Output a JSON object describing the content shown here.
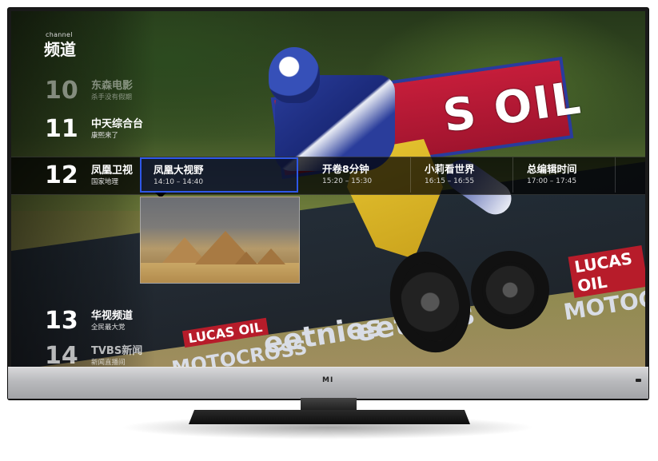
{
  "header": {
    "caption": "channel",
    "title": "频道"
  },
  "channels_above": [
    {
      "number": "10",
      "name": "东森电影",
      "program": "杀手没有假期"
    },
    {
      "number": "11",
      "name": "中天综合台",
      "program": "康熙来了"
    }
  ],
  "current_channel": {
    "number": "12",
    "name": "凤凰卫视",
    "program": "国家地理"
  },
  "programs": [
    {
      "title": "凤凰大视野",
      "time": "14:10 – 14:40",
      "selected": true
    },
    {
      "title": "开卷8分钟",
      "time": "15:20 – 15:30",
      "selected": false
    },
    {
      "title": "小莉看世界",
      "time": "16:15 – 16:55",
      "selected": false
    },
    {
      "title": "总编辑时间",
      "time": "17:00 – 17:45",
      "selected": false
    }
  ],
  "channels_below": [
    {
      "number": "13",
      "name": "华视频道",
      "program": "全民最大党"
    },
    {
      "number": "14",
      "name": "TVBS新闻",
      "program": "新闻直播间"
    }
  ],
  "background_signage": {
    "top_banner": "S OIL",
    "barrier_1": "eetnies",
    "barrier_2": "eetnies",
    "barrier_3": "MOTOCROSS",
    "barrier_4": "MOTOCROSS",
    "barrier_5": "LUCAS OIL",
    "barrier_6": "LUCAS OIL"
  },
  "tv": {
    "brand_logo": "MI"
  },
  "colors": {
    "selection_border": "#2e57e8",
    "strip_background": "#000000",
    "text_primary": "#ffffff"
  }
}
